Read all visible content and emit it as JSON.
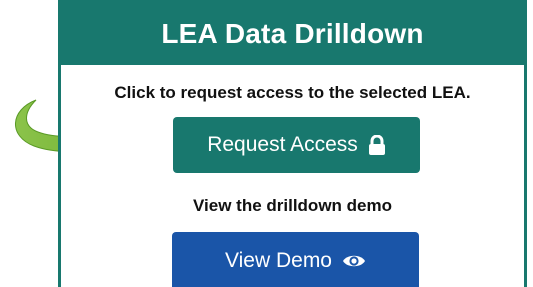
{
  "panel": {
    "title": "LEA Data Drilldown",
    "prompt": "Click to request access to the selected LEA.",
    "request_button": {
      "label": "Request Access",
      "icon": "lock-icon",
      "color": "#18786e"
    },
    "demo_label": "View the drilldown demo",
    "demo_button": {
      "label": "View Demo",
      "icon": "eye-icon",
      "color": "#1a55a8"
    }
  },
  "arrow": {
    "icon": "curved-arrow-icon",
    "color": "#7dc142"
  }
}
